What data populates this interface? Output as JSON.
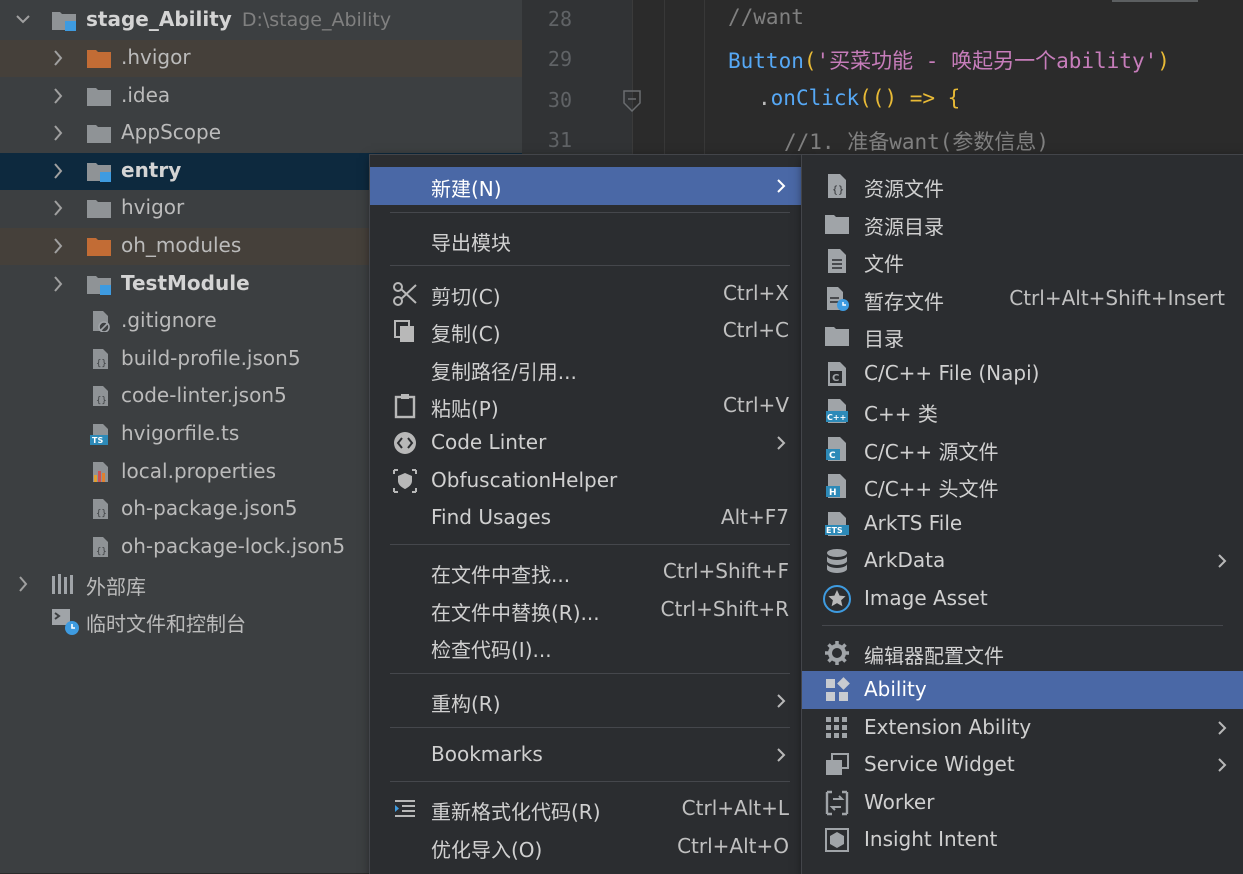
{
  "tree": {
    "root": {
      "name": "stage_Ability",
      "path": "D:\\stage_Ability"
    },
    "items": [
      {
        "label": ".hvigor",
        "icon": "folder-orange-icon"
      },
      {
        "label": ".idea",
        "icon": "folder-icon"
      },
      {
        "label": "AppScope",
        "icon": "folder-icon"
      },
      {
        "label": "entry",
        "icon": "module-folder-icon"
      },
      {
        "label": "hvigor",
        "icon": "folder-icon"
      },
      {
        "label": "oh_modules",
        "icon": "folder-orange-icon"
      },
      {
        "label": "TestModule",
        "icon": "module-folder-icon"
      },
      {
        "label": ".gitignore",
        "icon": "ignore-file-icon"
      },
      {
        "label": "build-profile.json5",
        "icon": "json5-file-icon"
      },
      {
        "label": "code-linter.json5",
        "icon": "json5-file-icon"
      },
      {
        "label": "hvigorfile.ts",
        "icon": "ts-file-icon"
      },
      {
        "label": "local.properties",
        "icon": "properties-file-icon"
      },
      {
        "label": "oh-package.json5",
        "icon": "json5-file-icon"
      },
      {
        "label": "oh-package-lock.json5",
        "icon": "json5-file-icon"
      }
    ],
    "external_libs": "外部库",
    "scratches": "临时文件和控制台"
  },
  "editor": {
    "lines": [
      {
        "num": "28",
        "comment": "//want"
      },
      {
        "num": "29",
        "fn": "Button",
        "paren_open": "(",
        "str": "'买菜功能 - 唤起另一个ability'",
        "paren_close": ")"
      },
      {
        "num": "30",
        "dot": ".",
        "method": "onClick",
        "rest": "(() => {"
      },
      {
        "num": "31",
        "comment": "//1. 准备want(参数信息)"
      }
    ]
  },
  "context_menu": {
    "new": {
      "label": "新建(N)"
    },
    "export_module": "导出模块",
    "cut": {
      "label": "剪切(C)",
      "shortcut": "Ctrl+X"
    },
    "copy": {
      "label": "复制(C)",
      "shortcut": "Ctrl+C"
    },
    "copy_path": "复制路径/引用...",
    "paste": {
      "label": "粘贴(P)",
      "shortcut": "Ctrl+V"
    },
    "code_linter": "Code Linter",
    "obfuscation": "ObfuscationHelper",
    "find_usages": {
      "label": "Find Usages",
      "shortcut": "Alt+F7"
    },
    "find_in_files": {
      "label": "在文件中查找...",
      "shortcut": "Ctrl+Shift+F"
    },
    "replace_in_files": {
      "label": "在文件中替换(R)...",
      "shortcut": "Ctrl+Shift+R"
    },
    "inspect_code": "检查代码(I)...",
    "refactor": "重构(R)",
    "bookmarks": "Bookmarks",
    "reformat": {
      "label": "重新格式化代码(R)",
      "shortcut": "Ctrl+Alt+L"
    },
    "optimize_imports": {
      "label": "优化导入(O)",
      "shortcut": "Ctrl+Alt+O"
    }
  },
  "new_submenu": {
    "resource_file": "资源文件",
    "resource_dir": "资源目录",
    "file": "文件",
    "scratch_file": {
      "label": "暂存文件",
      "shortcut": "Ctrl+Alt+Shift+Insert"
    },
    "directory": "目录",
    "napi_file": "C/C++ File (Napi)",
    "cpp_class": "C++ 类",
    "cpp_source": "C/C++ 源文件",
    "cpp_header": "C/C++ 头文件",
    "arkts_file": "ArkTS File",
    "arkdata": "ArkData",
    "image_asset": "Image Asset",
    "editor_config": "编辑器配置文件",
    "ability": "Ability",
    "extension_ability": "Extension Ability",
    "service_widget": "Service Widget",
    "worker": "Worker",
    "insight_intent": "Insight Intent"
  },
  "colors": {
    "selection": "#4a68a6",
    "tree_bg": "#3c3f41",
    "editor_bg": "#2b2b2b",
    "menu_bg": "#2b2d30",
    "comment": "#808080",
    "keyword_fn": "#56a8f5",
    "string": "#c77dbb",
    "bracket": "#e8ba36"
  }
}
